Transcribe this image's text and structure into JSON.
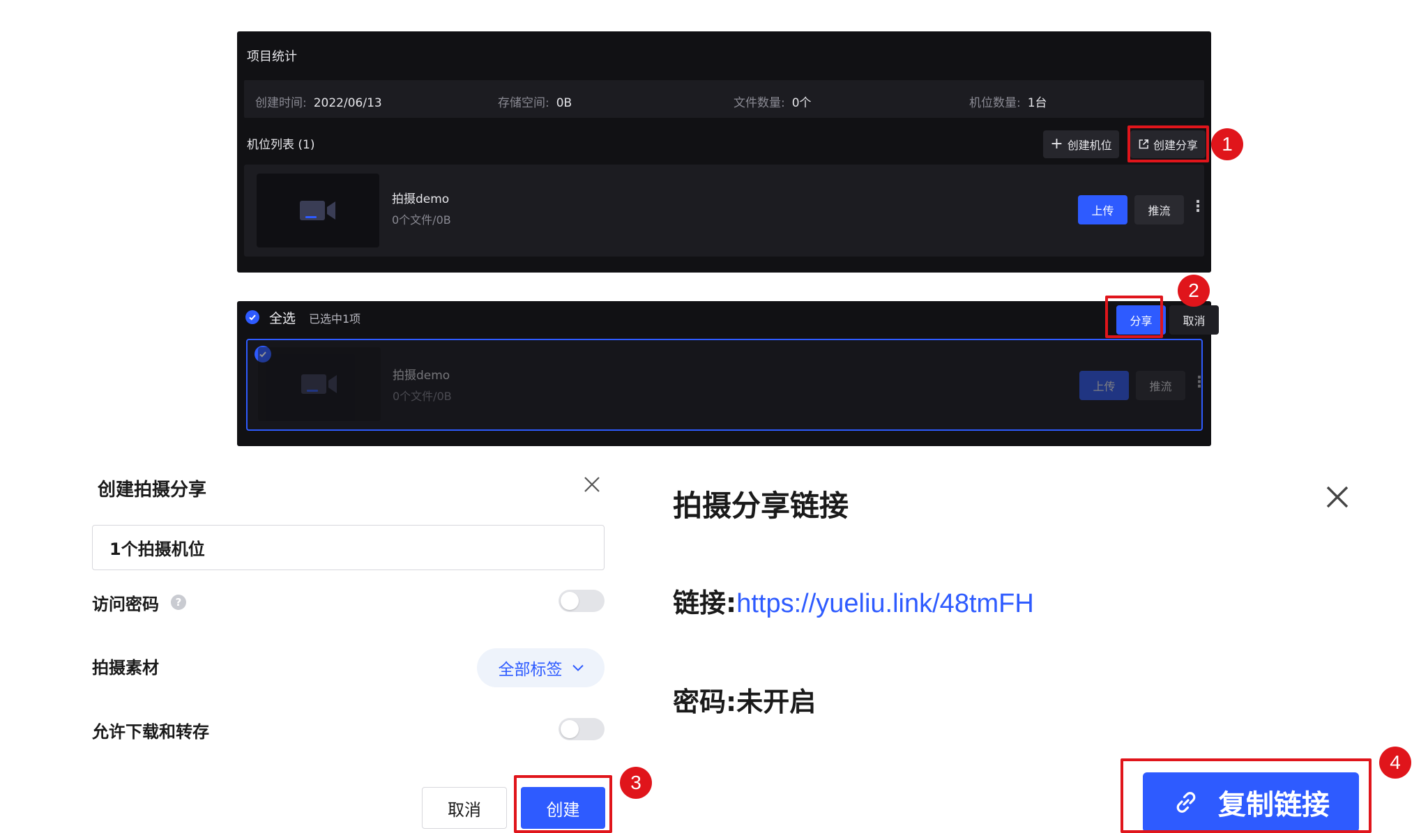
{
  "project_stats": {
    "title": "项目统计",
    "created_label": "创建时间:",
    "created_value": "2022/06/13",
    "storage_label": "存储空间:",
    "storage_value": "0B",
    "files_label": "文件数量:",
    "files_value": "0个",
    "positions_label": "机位数量:",
    "positions_value": "1台"
  },
  "position_list": {
    "title": "机位列表 (1)",
    "create_position_label": "创建机位",
    "create_share_label": "创建分享"
  },
  "position_item": {
    "name": "拍摄demo",
    "meta": "0个文件/0B",
    "upload_label": "上传",
    "stream_label": "推流"
  },
  "selection_bar": {
    "select_all_label": "全选",
    "selected_count": "已选中1项",
    "share_label": "分享",
    "cancel_label": "取消"
  },
  "create_share_dialog": {
    "title": "创建拍摄分享",
    "input_value": "1个拍摄机位",
    "password_label": "访问密码",
    "material_label": "拍摄素材",
    "material_select": "全部标签",
    "download_label": "允许下载和转存",
    "cancel_label": "取消",
    "create_label": "创建"
  },
  "share_link_dialog": {
    "title": "拍摄分享链接",
    "link_label": "链接:",
    "link_value": "https://yueliu.link/48tmFH",
    "password_label": "密码:",
    "password_value": "未开启",
    "copy_label": "复制链接"
  },
  "step_badges": [
    "1",
    "2",
    "3",
    "4"
  ],
  "colors": {
    "accent": "#2e5bff",
    "highlight": "#e0151b",
    "panel_bg": "#111114"
  }
}
